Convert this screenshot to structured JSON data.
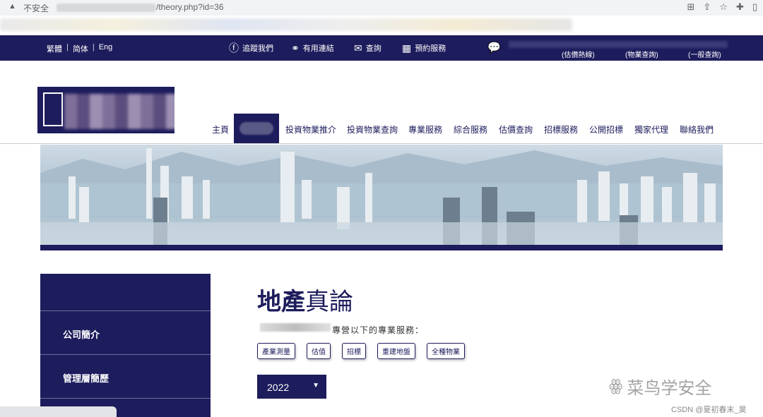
{
  "browser": {
    "security_label": "不安全",
    "url_path": "/theory.php?id=36",
    "warning_icon": "warning-icon"
  },
  "topbar": {
    "lang_trad": "繁體",
    "lang_simp": "简体",
    "lang_eng": "Eng",
    "sep": "|",
    "follow_label": "追蹤我們",
    "links_label": "有用連結",
    "inquiry_label": "查詢",
    "booking_label": "預約服務",
    "hotline_valuation": "(估價熱線)",
    "hotline_property": "(物業查詢)",
    "hotline_general": "(一般查詢)"
  },
  "nav": {
    "items": [
      "主頁",
      "投資物業推介",
      "投資物業查詢",
      "專業服務",
      "綜合服務",
      "估價查詢",
      "招標服務",
      "公開招標",
      "獨家代理",
      "聯絡我們"
    ]
  },
  "sidebar": {
    "items": [
      "公司簡介",
      "管理層簡歷"
    ]
  },
  "content": {
    "title_bold": "地產",
    "title_thin": "真論",
    "intro": "專營以下的專業服務：",
    "tags": [
      "產業測量",
      "估值",
      "招標",
      "重建地盤",
      "全種物業"
    ],
    "year": "2022"
  },
  "watermark": {
    "text": "菜鸟学安全",
    "csdn": "CSDN @夏初春末_昊"
  },
  "colors": {
    "navy": "#1d1c5c"
  }
}
